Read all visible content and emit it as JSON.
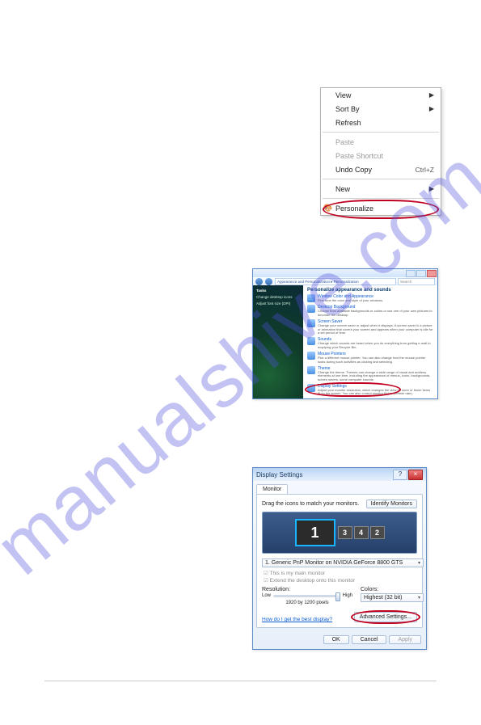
{
  "watermark": "manualshive.com",
  "fig1": {
    "items": [
      {
        "label": "View",
        "arrow": true
      },
      {
        "label": "Sort By",
        "arrow": true
      },
      {
        "label": "Refresh"
      },
      {
        "sep": true
      },
      {
        "label": "Paste",
        "disabled": true
      },
      {
        "label": "Paste Shortcut",
        "disabled": true
      },
      {
        "label": "Undo Copy",
        "shortcut": "Ctrl+Z"
      },
      {
        "sep": true
      },
      {
        "label": "New",
        "arrow": true
      },
      {
        "sep": true
      },
      {
        "label": "Personalize",
        "icon": "🎨",
        "circled": true
      }
    ]
  },
  "fig2": {
    "breadcrumb": "Appearance and Personalization ▸ Personalization",
    "search_placeholder": "Search",
    "side_header": "Tasks",
    "side_links": [
      "Change desktop icons",
      "Adjust font size (DPI)"
    ],
    "heading": "Personalize appearance and sounds",
    "entries": [
      {
        "title": "Window Color and Appearance",
        "desc": "Fine tune the color and style of your windows."
      },
      {
        "title": "Desktop Background",
        "desc": "Choose from available backgrounds or colors or use one of your own pictures to decorate the desktop."
      },
      {
        "title": "Screen Saver",
        "desc": "Change your screen saver or adjust when it displays. A screen saver is a picture or animation that covers your screen and appears when your computer is idle for a set period of time."
      },
      {
        "title": "Sounds",
        "desc": "Change which sounds are heard when you do everything from getting e-mail to emptying your Recycle Bin."
      },
      {
        "title": "Mouse Pointers",
        "desc": "Pick a different mouse pointer. You can also change how the mouse pointer looks during such activities as clicking and selecting."
      },
      {
        "title": "Theme",
        "desc": "Change the theme. Themes can change a wide range of visual and auditory elements at one time, including the appearance of menus, icons, backgrounds, screen savers, some computer sounds."
      },
      {
        "title": "Display Settings",
        "desc": "Adjust your monitor resolution, which changes the view so more or fewer items fit on the screen. You can also control monitor flicker (refresh rate).",
        "circled": true
      }
    ]
  },
  "fig3": {
    "title": "Display Settings",
    "tab": "Monitor",
    "instruction": "Drag the icons to match your monitors.",
    "identify_btn": "Identify Monitors",
    "monitors": {
      "primary": "1",
      "others": [
        "3",
        "4",
        "2"
      ]
    },
    "dropdown": "1. Generic PnP Monitor on NVIDIA GeForce 8800 GTS",
    "chk_main": "This is my main monitor",
    "chk_extend": "Extend the desktop onto this monitor",
    "res_label": "Resolution:",
    "res_low": "Low",
    "res_high": "High",
    "res_value": "1920 by 1200 pixels",
    "color_label": "Colors:",
    "color_value": "Highest (32 bit)",
    "link": "How do I get the best display?",
    "adv_btn": "Advanced Settings...",
    "btn_ok": "OK",
    "btn_cancel": "Cancel",
    "btn_apply": "Apply"
  }
}
